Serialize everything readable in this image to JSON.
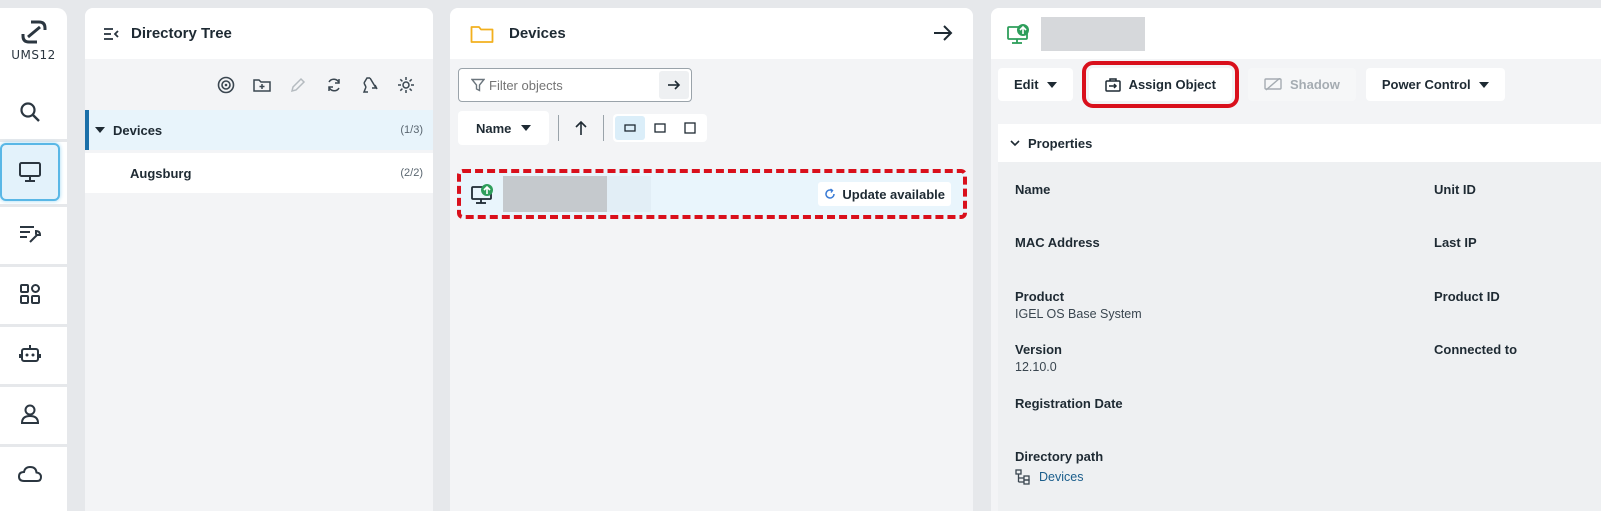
{
  "brand": {
    "logo_text": "UMS12"
  },
  "rail": {
    "items": [
      {
        "icon": "search-icon"
      },
      {
        "icon": "monitor-icon",
        "active": true
      },
      {
        "icon": "config-wrench-icon"
      },
      {
        "icon": "apps-icon"
      },
      {
        "icon": "robot-icon"
      },
      {
        "icon": "user-icon"
      },
      {
        "icon": "cloud-icon"
      }
    ]
  },
  "tree": {
    "title": "Directory Tree",
    "rows": [
      {
        "label": "Devices",
        "count": "(1/3)"
      },
      {
        "label": "Augsburg",
        "count": "(2/2)"
      }
    ]
  },
  "devices": {
    "title": "Devices",
    "filter_placeholder": "Filter objects",
    "sort_label": "Name",
    "row": {
      "badge": "Update available"
    }
  },
  "details": {
    "toolbar": {
      "edit": "Edit",
      "assign": "Assign Object",
      "shadow": "Shadow",
      "power": "Power Control"
    },
    "properties_title": "Properties",
    "fields": {
      "name": {
        "label": "Name",
        "value": ""
      },
      "unit_id": {
        "label": "Unit ID",
        "value": ""
      },
      "mac": {
        "label": "MAC Address",
        "value": ""
      },
      "last_ip": {
        "label": "Last IP",
        "value": ""
      },
      "product": {
        "label": "Product",
        "value": "IGEL OS Base System"
      },
      "product_id": {
        "label": "Product ID",
        "value": ""
      },
      "version": {
        "label": "Version",
        "value": "12.10.0"
      },
      "connected_to": {
        "label": "Connected to",
        "value": ""
      },
      "registration_date": {
        "label": "Registration Date",
        "value": ""
      },
      "directory_path": {
        "label": "Directory path",
        "value": "Devices"
      }
    }
  },
  "colors": {
    "accent": "#1b6fa8",
    "highlight": "#d9101c",
    "folder": "#f2b01e",
    "device_green": "#2e9e5b"
  }
}
